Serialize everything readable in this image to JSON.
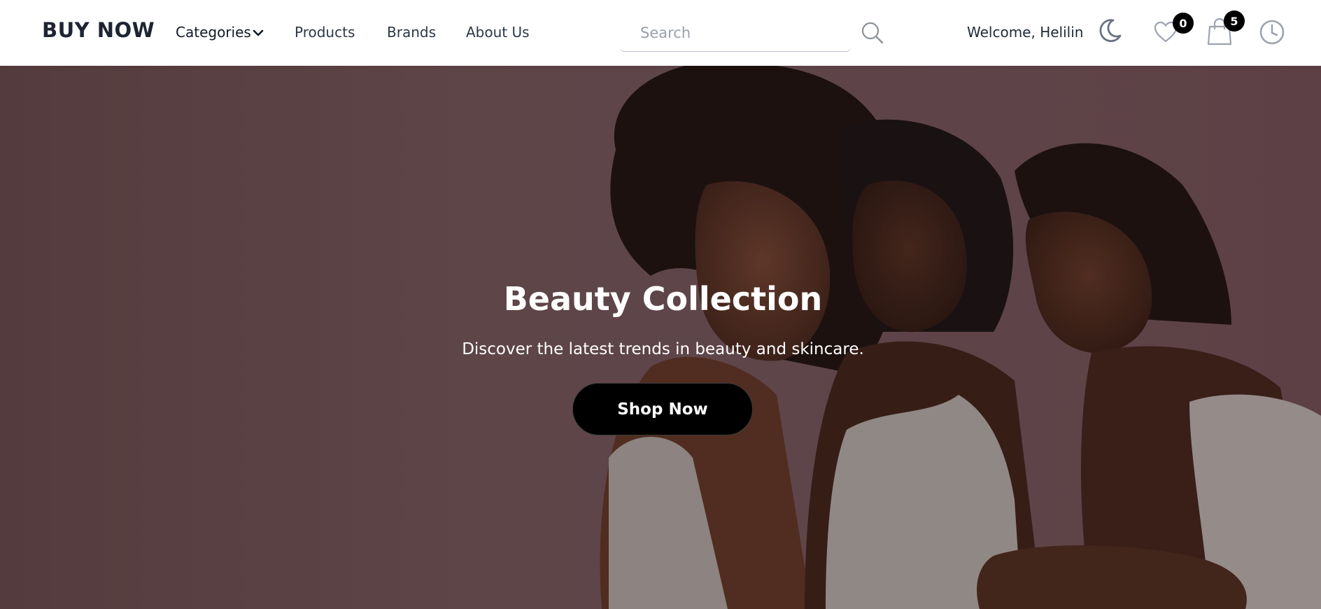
{
  "brand": "BUY NOW",
  "nav": {
    "categories": "Categories",
    "products": "Products",
    "brands": "Brands",
    "about": "About Us"
  },
  "search": {
    "placeholder": "Search"
  },
  "user": {
    "welcome": "Welcome, Helilin"
  },
  "badges": {
    "favorites": "0",
    "cart": "5"
  },
  "icons": [
    "chevron-down-icon",
    "search-icon",
    "moon-icon",
    "heart-icon",
    "shopping-bag-icon",
    "clock-icon"
  ],
  "hero": {
    "title": "Beauty Collection",
    "subtitle": "Discover the latest trends in beauty and skincare.",
    "cta": "Shop Now"
  },
  "colors": {
    "brand_text": "#1e2433",
    "hero_tint": "#6a5052",
    "button_bg": "#000000",
    "badge_bg": "#000000",
    "icon_gray": "#6b7280"
  }
}
